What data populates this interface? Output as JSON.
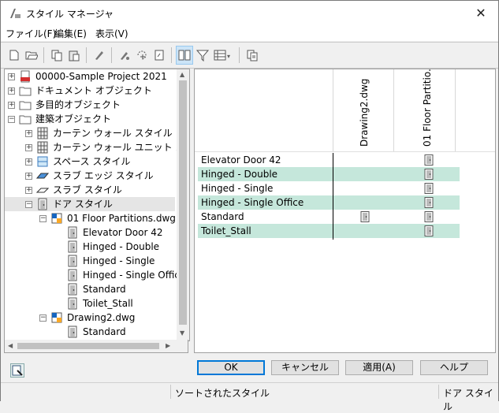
{
  "window": {
    "title": "スタイル マネージャ",
    "close_symbol": "✕"
  },
  "menu": [
    {
      "label": "ファイル(F)"
    },
    {
      "label": "編集(E)"
    },
    {
      "label": "表示(V)"
    }
  ],
  "tree": {
    "items": [
      {
        "label": "00000-Sample Project 2021",
        "icon": "pdf-project-icon"
      },
      {
        "label": "ドキュメント オブジェクト",
        "icon": "folder-icon"
      },
      {
        "label": "多目的オブジェクト",
        "icon": "folder-icon"
      },
      {
        "label": "建築オブジェクト",
        "icon": "folder-icon"
      },
      {
        "label": "カーテン ウォール スタイル",
        "icon": "curtain-wall-icon"
      },
      {
        "label": "カーテン ウォール ユニット スタイル",
        "icon": "curtain-wall-unit-icon"
      },
      {
        "label": "スペース スタイル",
        "icon": "space-icon"
      },
      {
        "label": "スラブ エッジ スタイル",
        "icon": "slab-edge-icon"
      },
      {
        "label": "スラブ スタイル",
        "icon": "slab-icon"
      },
      {
        "label": "ドア スタイル",
        "icon": "door-icon"
      },
      {
        "label": "01 Floor Partitions.dwg",
        "icon": "dwg-file-icon"
      },
      {
        "label": "Elevator Door 42",
        "icon": "door-icon"
      },
      {
        "label": "Hinged - Double",
        "icon": "door-icon"
      },
      {
        "label": "Hinged - Single",
        "icon": "door-icon"
      },
      {
        "label": "Hinged - Single Office",
        "icon": "door-icon"
      },
      {
        "label": "Standard",
        "icon": "door-icon"
      },
      {
        "label": "Toilet_Stall",
        "icon": "door-icon"
      },
      {
        "label": "Drawing2.dwg",
        "icon": "dwg-file-icon"
      },
      {
        "label": "Standard",
        "icon": "door-icon"
      }
    ]
  },
  "grid": {
    "columns": [
      "Drawing2.dwg",
      "01 Floor Partitio..."
    ],
    "rows": [
      {
        "label": "Elevator Door 42",
        "in_drawing2": false,
        "in_floor": true
      },
      {
        "label": "Hinged - Double",
        "in_drawing2": false,
        "in_floor": true
      },
      {
        "label": "Hinged - Single",
        "in_drawing2": false,
        "in_floor": true
      },
      {
        "label": "Hinged - Single Office",
        "in_drawing2": false,
        "in_floor": true
      },
      {
        "label": "Standard",
        "in_drawing2": true,
        "in_floor": true
      },
      {
        "label": "Toilet_Stall",
        "in_drawing2": false,
        "in_floor": true
      }
    ]
  },
  "buttons": {
    "ok": "OK",
    "cancel": "キャンセル",
    "apply": "適用(A)",
    "help": "ヘルプ"
  },
  "status": {
    "center": "ソートされたスタイル",
    "right": "ドア スタイル"
  },
  "colors": {
    "row_highlight": "#c5e7db",
    "accent": "#0078d7"
  }
}
